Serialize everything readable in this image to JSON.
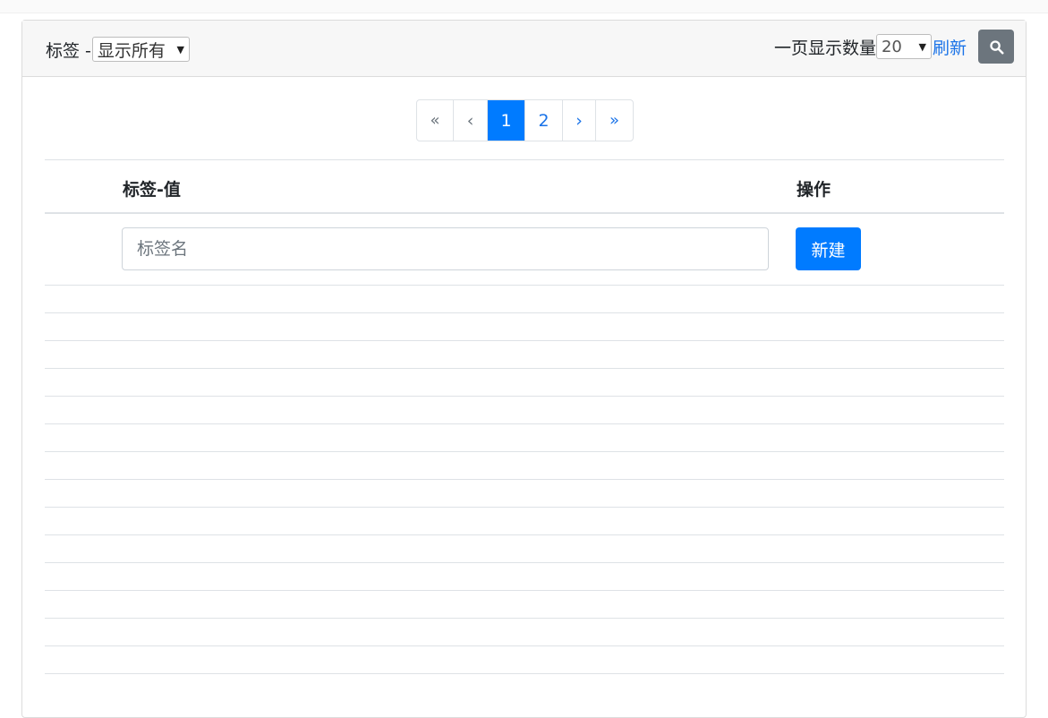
{
  "header": {
    "tag_label": "标签 -",
    "tag_filter": {
      "selected": "显示所有"
    },
    "per_page_label": "一页显示数量",
    "per_page": {
      "selected": "20"
    },
    "refresh_label": "刷新",
    "search_icon": "search-icon"
  },
  "pagination": {
    "first": "«",
    "prev": "‹",
    "pages": [
      "1",
      "2"
    ],
    "current": "1",
    "next": "›",
    "last": "»"
  },
  "table": {
    "columns": [
      "标签-值",
      "操作"
    ],
    "new_row": {
      "input_placeholder": "标签名",
      "input_value": "",
      "button_label": "新建"
    },
    "rows": []
  },
  "colors": {
    "primary": "#007bff",
    "secondary": "#6c757d",
    "link": "#1a73e8"
  }
}
